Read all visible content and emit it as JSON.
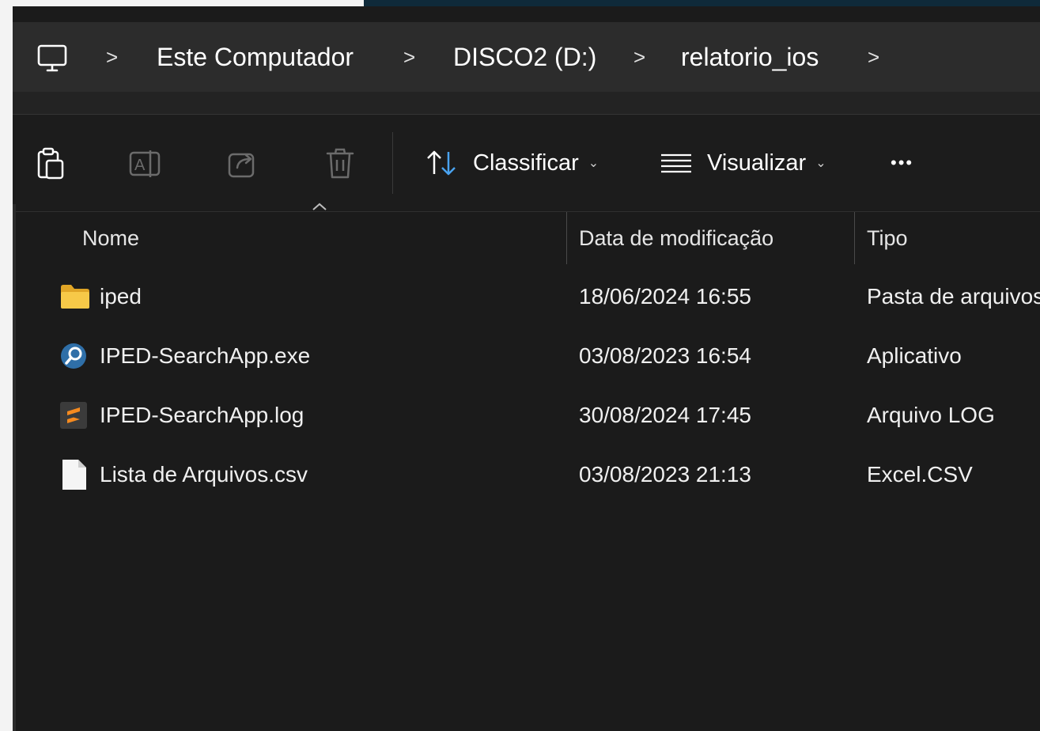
{
  "breadcrumb": {
    "items": [
      {
        "label": "Este Computador"
      },
      {
        "label": "DISCO2 (D:)"
      },
      {
        "label": "relatorio_ios"
      }
    ],
    "separator": ">"
  },
  "toolbar": {
    "sort_label": "Classificar",
    "view_label": "Visualizar",
    "more_label": "•••",
    "icons": [
      "paste-icon",
      "rename-icon",
      "share-icon",
      "delete-icon"
    ]
  },
  "columns": {
    "name": "Nome",
    "modified": "Data de modificação",
    "type": "Tipo"
  },
  "files": [
    {
      "name": "iped",
      "modified": "18/06/2024 16:55",
      "type": "Pasta de arquivos",
      "icon": "folder-icon"
    },
    {
      "name": "IPED-SearchApp.exe",
      "modified": "03/08/2023 16:54",
      "type": "Aplicativo",
      "icon": "search-app-icon"
    },
    {
      "name": "IPED-SearchApp.log",
      "modified": "30/08/2024 17:45",
      "type": "Arquivo LOG",
      "icon": "sublime-log-icon"
    },
    {
      "name": "Lista de Arquivos.csv",
      "modified": "03/08/2023 21:13",
      "type": "Excel.CSV",
      "icon": "document-icon"
    }
  ],
  "colors": {
    "accent_blue": "#4aa3f0",
    "folder_yellow": "#f7c948",
    "log_orange": "#f58a1f"
  }
}
